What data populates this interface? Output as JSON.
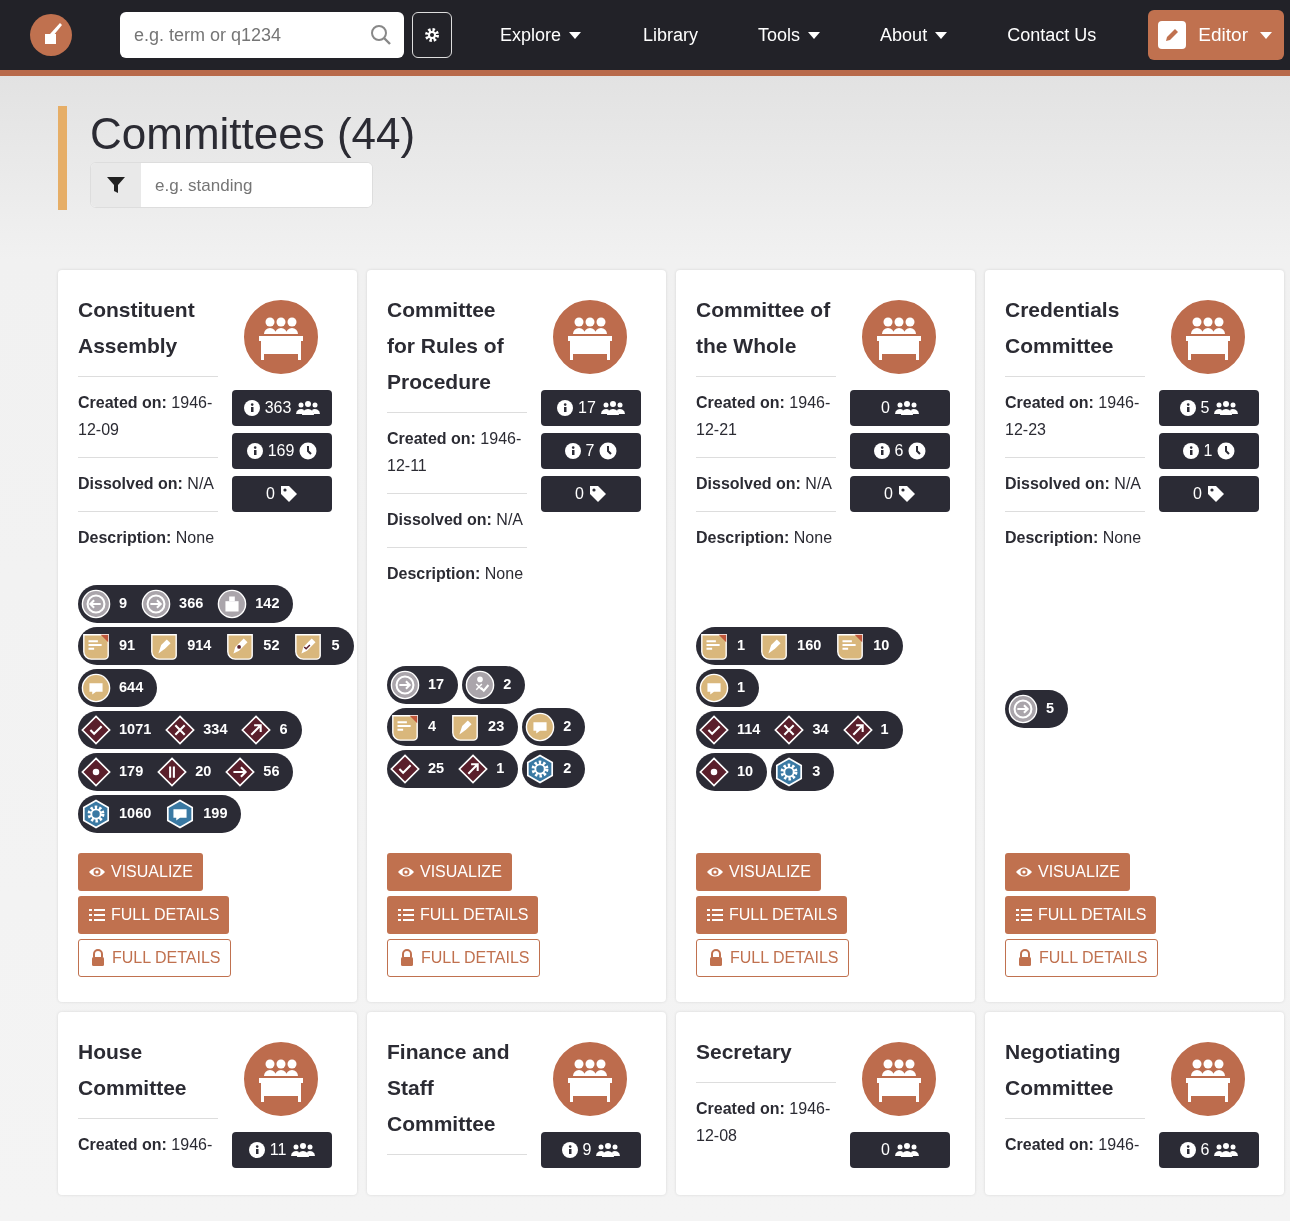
{
  "navbar": {
    "search": {
      "placeholder": "e.g. term or q1234"
    },
    "menu": [
      {
        "label": "Explore",
        "dropdown": true
      },
      {
        "label": "Library",
        "dropdown": false
      },
      {
        "label": "Tools",
        "dropdown": true
      },
      {
        "label": "About",
        "dropdown": true
      },
      {
        "label": "Contact Us",
        "dropdown": false
      }
    ],
    "editor": {
      "label": "Editor"
    }
  },
  "heading": {
    "title": "Committees (44)",
    "filter": {
      "placeholder": "e.g. standing"
    }
  },
  "cards": [
    {
      "title": "Constituent Assembly",
      "fields": [
        "**Created on:** 1946-12-09",
        "**Dissolved on:** N/A",
        "**Description:** None"
      ],
      "badges": [
        {
          "kind": "members",
          "info": true,
          "count": "363"
        },
        {
          "kind": "events",
          "info": true,
          "count": "169"
        },
        {
          "kind": "tags",
          "info": false,
          "count": "0"
        }
      ],
      "pill_groups": [
        [
          {
            "kind": "withdrawn",
            "count": "9"
          },
          {
            "kind": "joined",
            "count": "366"
          },
          {
            "kind": "ballot",
            "count": "142"
          }
        ],
        [
          {
            "kind": "doc-add",
            "count": "91"
          },
          {
            "kind": "pen",
            "count": "914"
          },
          {
            "kind": "pen-dot",
            "count": "52"
          },
          {
            "kind": "pen-check",
            "count": "5"
          }
        ],
        [
          {
            "kind": "speech",
            "count": "644"
          }
        ],
        [
          {
            "kind": "check",
            "count": "1071"
          },
          {
            "kind": "cross",
            "count": "334"
          },
          {
            "kind": "arrow-ne",
            "count": "6"
          }
        ],
        [
          {
            "kind": "dot",
            "count": "179"
          },
          {
            "kind": "pause",
            "count": "20"
          },
          {
            "kind": "arrow-right",
            "count": "56"
          }
        ],
        [
          {
            "kind": "gear",
            "count": "1060"
          },
          {
            "kind": "speech-blue",
            "count": "199"
          }
        ]
      ],
      "buttons": [
        {
          "kind": "visualize",
          "label": "VISUALIZE"
        },
        {
          "kind": "details",
          "label": "FULL DETAILS"
        },
        {
          "kind": "locked",
          "label": "FULL DETAILS"
        }
      ]
    },
    {
      "title": "Committee for Rules of Procedure",
      "fields": [
        "**Created on:** 1946-12-11",
        "**Dissolved on:** N/A",
        "**Description:** None"
      ],
      "badges": [
        {
          "kind": "members",
          "info": true,
          "count": "17"
        },
        {
          "kind": "events",
          "info": true,
          "count": "7"
        },
        {
          "kind": "tags",
          "info": false,
          "count": "0"
        }
      ],
      "pill_groups": [
        [
          {
            "kind": "joined",
            "count": "17"
          }
        ],
        [
          {
            "kind": "person-check",
            "count": "2"
          }
        ],
        [
          {
            "kind": "doc-add",
            "count": "4"
          },
          {
            "kind": "pen",
            "count": "23"
          }
        ],
        [
          {
            "kind": "speech",
            "count": "2"
          }
        ],
        [
          {
            "kind": "check",
            "count": "25"
          },
          {
            "kind": "arrow-ne",
            "count": "1"
          }
        ],
        [
          {
            "kind": "gear",
            "count": "2"
          }
        ]
      ],
      "buttons": [
        {
          "kind": "visualize",
          "label": "VISUALIZE"
        },
        {
          "kind": "details",
          "label": "FULL DETAILS"
        },
        {
          "kind": "locked",
          "label": "FULL DETAILS"
        }
      ]
    },
    {
      "title": "Committee of the Whole",
      "fields": [
        "**Created on:** 1946-12-21",
        "**Dissolved on:** N/A",
        "**Description:** None"
      ],
      "badges": [
        {
          "kind": "members",
          "info": false,
          "count": "0"
        },
        {
          "kind": "events",
          "info": true,
          "count": "6"
        },
        {
          "kind": "tags",
          "info": false,
          "count": "0"
        }
      ],
      "pill_groups": [
        [
          {
            "kind": "doc-add",
            "count": "1"
          },
          {
            "kind": "pen",
            "count": "160"
          },
          {
            "kind": "doc-check",
            "count": "10"
          }
        ],
        [
          {
            "kind": "speech",
            "count": "1"
          }
        ],
        [
          {
            "kind": "check",
            "count": "114"
          },
          {
            "kind": "cross",
            "count": "34"
          },
          {
            "kind": "arrow-ne",
            "count": "1"
          }
        ],
        [
          {
            "kind": "dot",
            "count": "10"
          }
        ],
        [
          {
            "kind": "gear",
            "count": "3"
          }
        ]
      ],
      "buttons": [
        {
          "kind": "visualize",
          "label": "VISUALIZE"
        },
        {
          "kind": "details",
          "label": "FULL DETAILS"
        },
        {
          "kind": "locked",
          "label": "FULL DETAILS"
        }
      ]
    },
    {
      "title": "Credentials Committee",
      "fields": [
        "**Created on:** 1946-12-23",
        "**Dissolved on:** N/A",
        "**Description:** None"
      ],
      "badges": [
        {
          "kind": "members",
          "info": true,
          "count": "5"
        },
        {
          "kind": "events",
          "info": true,
          "count": "1"
        },
        {
          "kind": "tags",
          "info": false,
          "count": "0"
        }
      ],
      "pill_groups": [
        [
          {
            "kind": "joined",
            "count": "5"
          }
        ]
      ],
      "buttons": [
        {
          "kind": "visualize",
          "label": "VISUALIZE"
        },
        {
          "kind": "details",
          "label": "FULL DETAILS"
        },
        {
          "kind": "locked",
          "label": "FULL DETAILS"
        }
      ]
    },
    {
      "title": "House Committee",
      "fields": [
        "**Created on:** 1946-"
      ],
      "badges": [
        {
          "kind": "members",
          "info": true,
          "count": "11"
        }
      ]
    },
    {
      "title": "Finance and Staff Committee",
      "badges": [
        {
          "kind": "members",
          "info": true,
          "count": "9"
        }
      ]
    },
    {
      "title": "Secretary",
      "fields": [
        "**Created on:** 1946-12-08"
      ],
      "badges": [
        {
          "kind": "members",
          "info": false,
          "count": "0"
        }
      ]
    },
    {
      "title": "Negotiating Committee",
      "fields": [
        "**Created on:** 1946-"
      ],
      "badges": [
        {
          "kind": "members",
          "info": true,
          "count": "6"
        }
      ]
    }
  ]
}
